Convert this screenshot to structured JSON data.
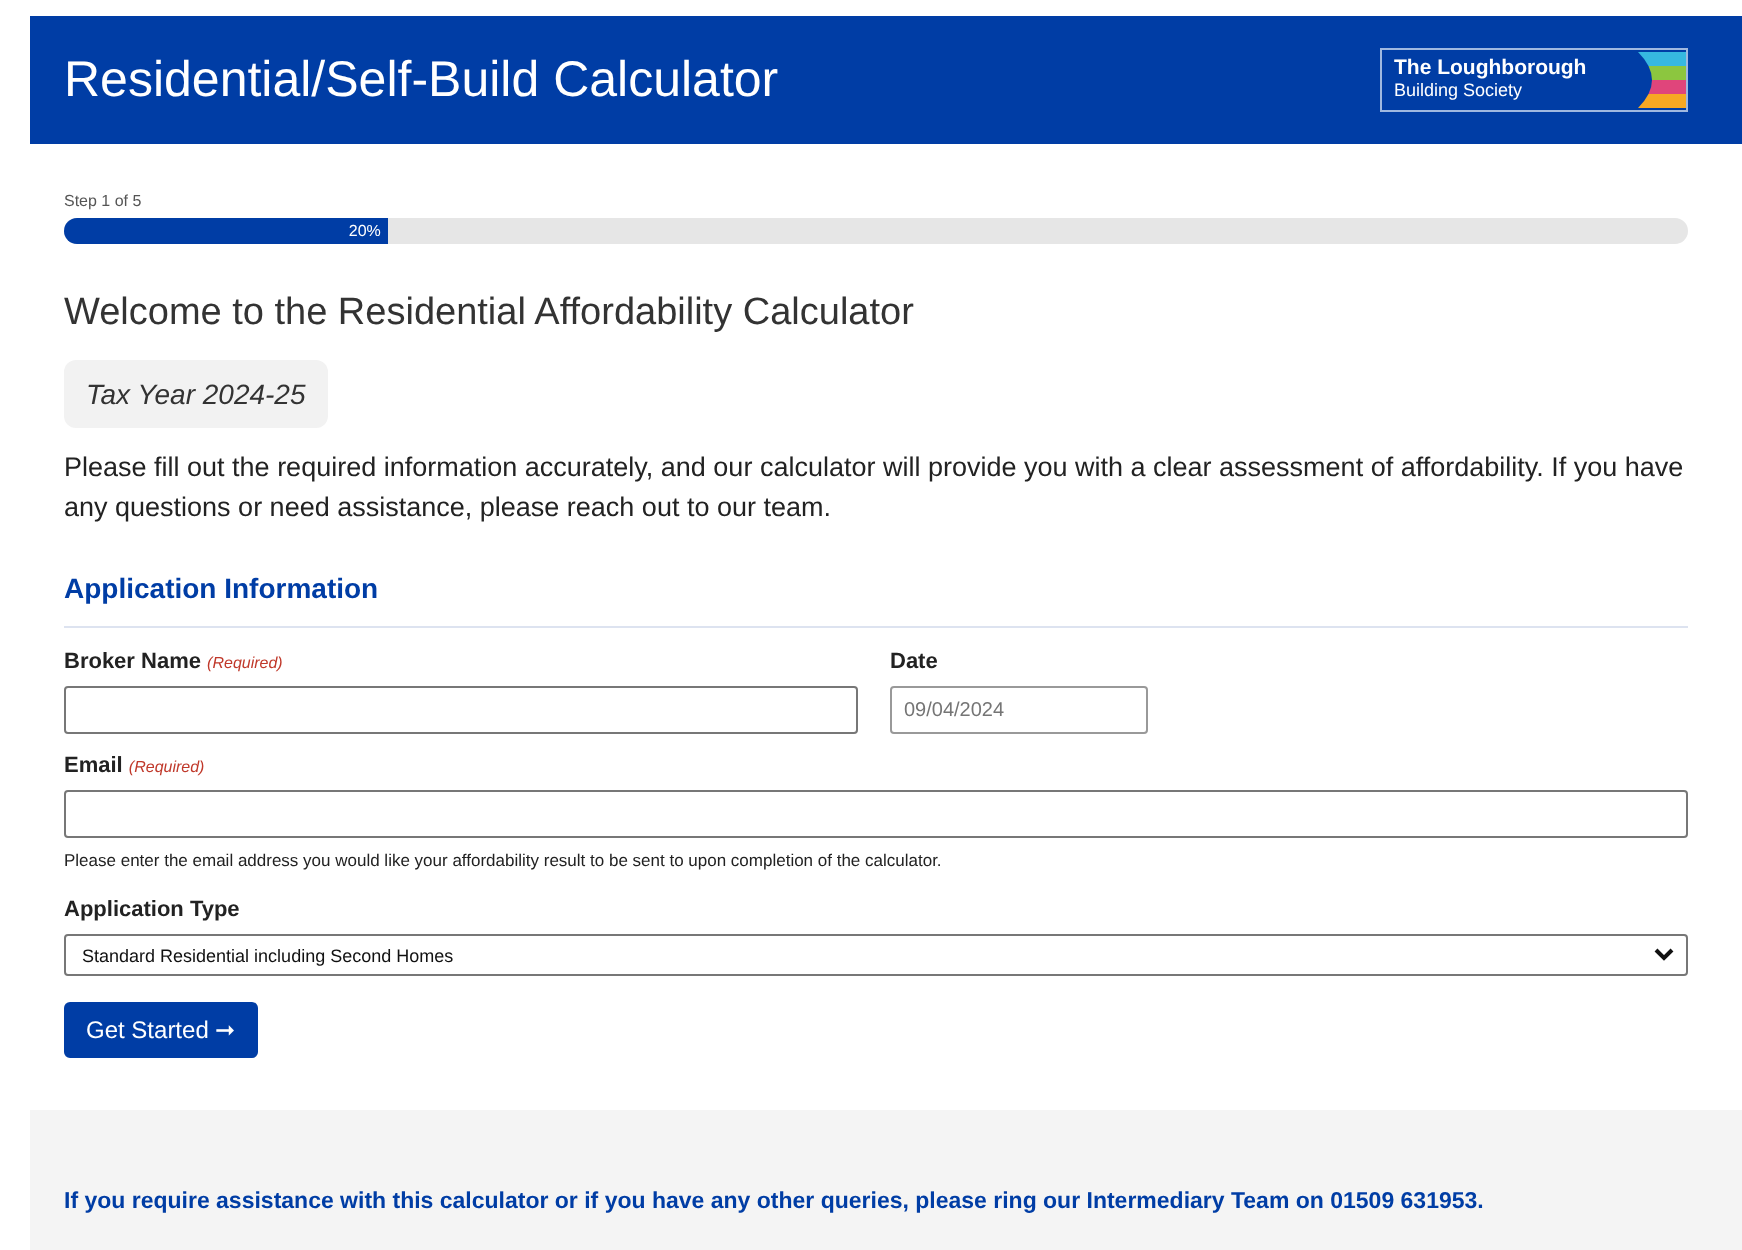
{
  "header": {
    "title": "Residential/Self-Build Calculator",
    "logo": {
      "line_1": "The Loughborough",
      "line_2": "Building Society"
    }
  },
  "progress": {
    "step": "Step 1 of 5",
    "level": 0.2,
    "reading": "20%"
  },
  "heading": "Welcome to the Residential Affordability Calculator",
  "tax_year": "Tax Year 2024-25",
  "intro": "Please fill out the required information accurately, and our calculator will provide you with a clear assessment of affordability. If you have any questions or need assistance, please reach out to our team.",
  "section_title": "Application Information",
  "fields": {
    "broker_name": {
      "label": "Broker Name",
      "required": "(Required)"
    },
    "date": {
      "label": "Date",
      "placeholder": "09/04/2024"
    },
    "email": {
      "label": "Email",
      "required": "(Required)",
      "help": "Please enter the email address you would like your affordability result to be sent to upon completion of the calculator."
    },
    "application_type": {
      "label": "Application Type",
      "value": "Standard Residential including Second Homes"
    }
  },
  "button": "Get Started ➞",
  "footer": "If you require assistance with this calculator or if you have any other queries, please ring our Intermediary Team on **01509 631953**."
}
